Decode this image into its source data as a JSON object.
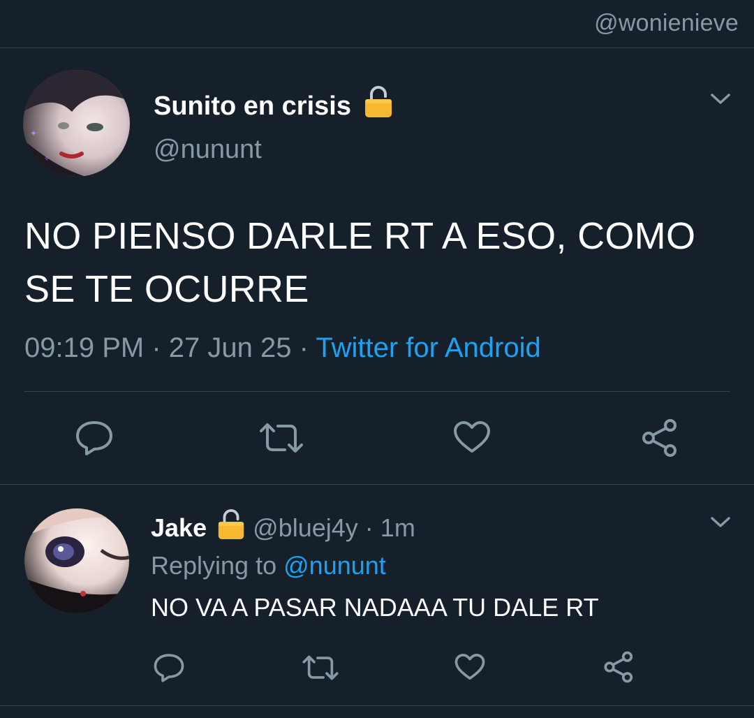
{
  "watermark": "@wonienieve",
  "main_tweet": {
    "display_name": "Sunito en crisis",
    "handle": "@nununt",
    "text_line1": "NO PIENSO DARLE RT A ESO, COMO",
    "text_line2": "SE TE OCURRE",
    "time": "09:19 PM",
    "date": "27 Jun 25",
    "separator": "·",
    "source": "Twitter for Android",
    "protected_icon": "lock-icon"
  },
  "reply": {
    "display_name": "Jake",
    "handle": "@bluej4y",
    "separator": "·",
    "age": "1m",
    "replying_prefix": "Replying to",
    "replying_handle": "@nununt",
    "text": "NO VA A PASAR NADAAA TU DALE RT",
    "protected_icon": "lock-icon"
  },
  "actions": [
    "reply-icon",
    "retweet-icon",
    "like-icon",
    "share-icon"
  ],
  "colors": {
    "background": "#15202b",
    "divider": "#38444d",
    "muted": "#8899a6",
    "link": "#1da1f2",
    "lock": "#f5b82e"
  }
}
